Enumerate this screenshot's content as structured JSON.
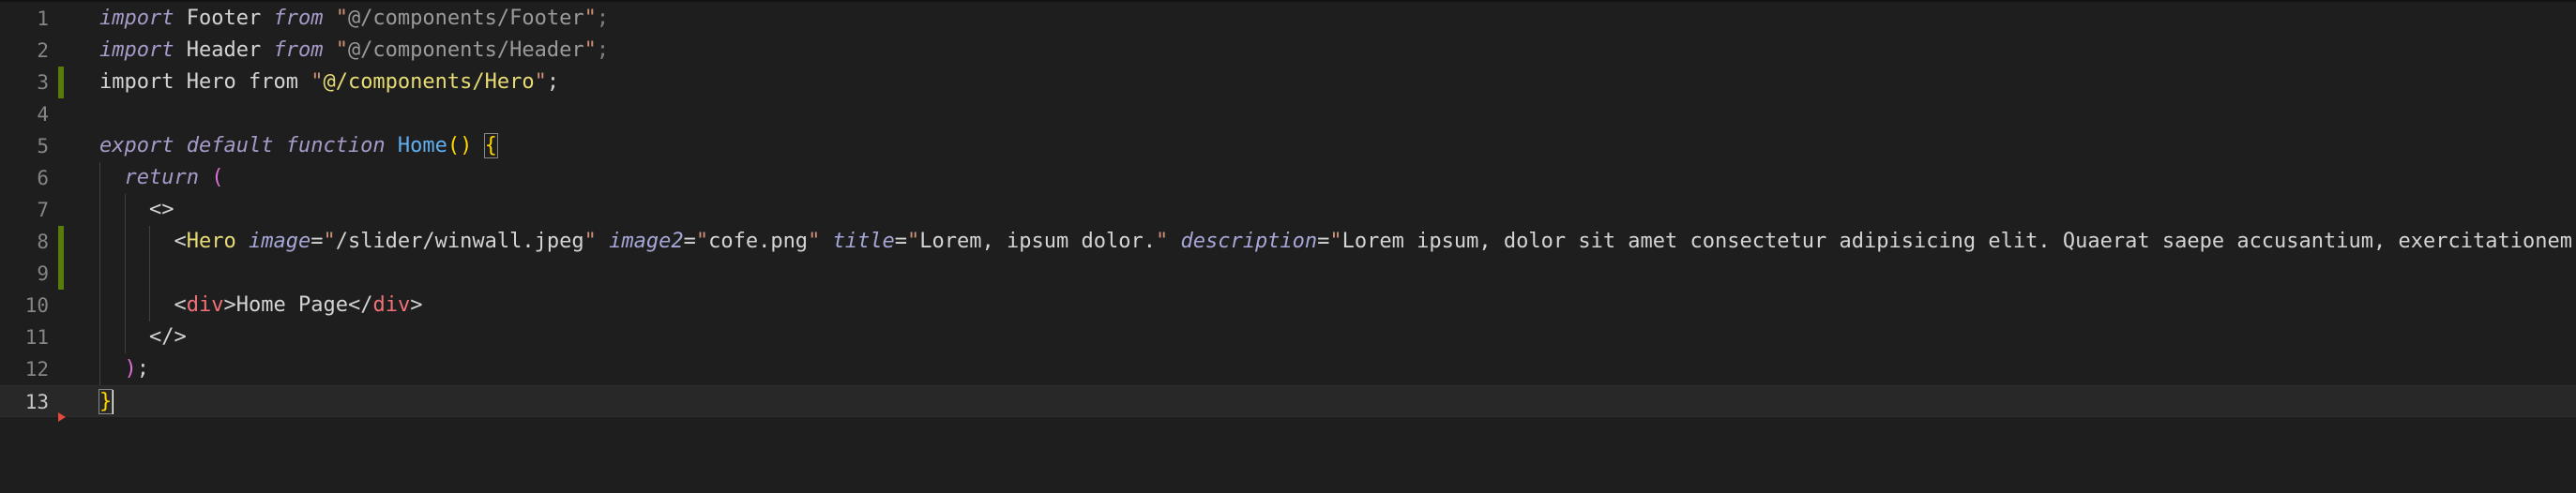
{
  "editor": {
    "lines": [
      {
        "num": "1",
        "tokens": [
          {
            "t": "import",
            "c": "kw-i2"
          },
          {
            "t": " Footer ",
            "c": "plain"
          },
          {
            "t": "from",
            "c": "kw-i2"
          },
          {
            "t": " ",
            "c": "plain"
          },
          {
            "t": "\"",
            "c": "str"
          },
          {
            "t": "@/components/Footer",
            "c": "gray"
          },
          {
            "t": "\"",
            "c": "str"
          },
          {
            "t": ";",
            "c": "dim"
          }
        ]
      },
      {
        "num": "2",
        "tokens": [
          {
            "t": "import",
            "c": "kw-i2"
          },
          {
            "t": " Header ",
            "c": "plain"
          },
          {
            "t": "from",
            "c": "kw-i2"
          },
          {
            "t": " ",
            "c": "plain"
          },
          {
            "t": "\"",
            "c": "str"
          },
          {
            "t": "@/components/Header",
            "c": "gray"
          },
          {
            "t": "\"",
            "c": "str"
          },
          {
            "t": ";",
            "c": "dim"
          }
        ]
      },
      {
        "num": "3",
        "tokens": [
          {
            "t": "import",
            "c": "plain"
          },
          {
            "t": " Hero ",
            "c": "plain"
          },
          {
            "t": "from",
            "c": "plain"
          },
          {
            "t": " ",
            "c": "plain"
          },
          {
            "t": "\"",
            "c": "str"
          },
          {
            "t": "@/components/Hero",
            "c": "str-y"
          },
          {
            "t": "\"",
            "c": "str"
          },
          {
            "t": ";",
            "c": "plain"
          }
        ]
      },
      {
        "num": "4",
        "tokens": []
      },
      {
        "num": "5",
        "tokens": [
          {
            "t": "export",
            "c": "kw-i2"
          },
          {
            "t": " ",
            "c": "plain"
          },
          {
            "t": "default",
            "c": "kw-i2"
          },
          {
            "t": " ",
            "c": "plain"
          },
          {
            "t": "function",
            "c": "kw-i2"
          },
          {
            "t": " ",
            "c": "plain"
          },
          {
            "t": "Home",
            "c": "fn"
          },
          {
            "t": "()",
            "c": "brace"
          },
          {
            "t": " ",
            "c": "plain"
          },
          {
            "t": "{",
            "c": "brace-active"
          }
        ]
      },
      {
        "num": "6",
        "tokens": [
          {
            "t": "  ",
            "c": "plain"
          },
          {
            "t": "return",
            "c": "kw-i2"
          },
          {
            "t": " ",
            "c": "plain"
          },
          {
            "t": "(",
            "c": "paren"
          }
        ]
      },
      {
        "num": "7",
        "tokens": [
          {
            "t": "    ",
            "c": "plain"
          },
          {
            "t": "<>",
            "c": "plain"
          }
        ]
      },
      {
        "num": "8",
        "tokens": [
          {
            "t": "      ",
            "c": "plain"
          },
          {
            "t": "<",
            "c": "plain"
          },
          {
            "t": "Hero",
            "c": "str-y"
          },
          {
            "t": " ",
            "c": "plain"
          },
          {
            "t": "image",
            "c": "attr"
          },
          {
            "t": "=",
            "c": "plain"
          },
          {
            "t": "\"",
            "c": "str"
          },
          {
            "t": "/slider/winwall.jpeg",
            "c": "plain"
          },
          {
            "t": "\"",
            "c": "str"
          },
          {
            "t": " ",
            "c": "plain"
          },
          {
            "t": "image2",
            "c": "attr"
          },
          {
            "t": "=",
            "c": "plain"
          },
          {
            "t": "\"",
            "c": "str"
          },
          {
            "t": "cofe.png",
            "c": "plain"
          },
          {
            "t": "\"",
            "c": "str"
          },
          {
            "t": " ",
            "c": "plain"
          },
          {
            "t": "title",
            "c": "attr"
          },
          {
            "t": "=",
            "c": "plain"
          },
          {
            "t": "\"",
            "c": "str"
          },
          {
            "t": "Lorem, ipsum dolor.",
            "c": "plain"
          },
          {
            "t": "\"",
            "c": "str"
          },
          {
            "t": " ",
            "c": "plain"
          },
          {
            "t": "description",
            "c": "attr"
          },
          {
            "t": "=",
            "c": "plain"
          },
          {
            "t": "\"",
            "c": "str"
          },
          {
            "t": "Lorem ipsum, dolor sit amet consectetur adipisicing elit. Quaerat saepe accusantium, exercitationem",
            "c": "plain"
          }
        ]
      },
      {
        "num": "9",
        "tokens": []
      },
      {
        "num": "10",
        "tokens": [
          {
            "t": "      ",
            "c": "plain"
          },
          {
            "t": "<",
            "c": "plain"
          },
          {
            "t": "div",
            "c": "tag-p"
          },
          {
            "t": ">",
            "c": "plain"
          },
          {
            "t": "Home Page",
            "c": "plain"
          },
          {
            "t": "</",
            "c": "plain"
          },
          {
            "t": "div",
            "c": "tag-p"
          },
          {
            "t": ">",
            "c": "plain"
          }
        ]
      },
      {
        "num": "11",
        "tokens": [
          {
            "t": "    ",
            "c": "plain"
          },
          {
            "t": "</>",
            "c": "plain"
          }
        ]
      },
      {
        "num": "12",
        "tokens": [
          {
            "t": "  ",
            "c": "plain"
          },
          {
            "t": ")",
            "c": "paren"
          },
          {
            "t": ";",
            "c": "plain"
          }
        ]
      },
      {
        "num": "13",
        "tokens": [
          {
            "t": "}",
            "c": "brace-active"
          }
        ]
      }
    ],
    "modified_lines": [
      "3",
      "8",
      "9"
    ],
    "current_line": "13",
    "colors": {
      "background": "#1e1e1e",
      "current_line_bg": "#282828",
      "git_added": "#587c0c",
      "line_number": "#858585"
    }
  }
}
